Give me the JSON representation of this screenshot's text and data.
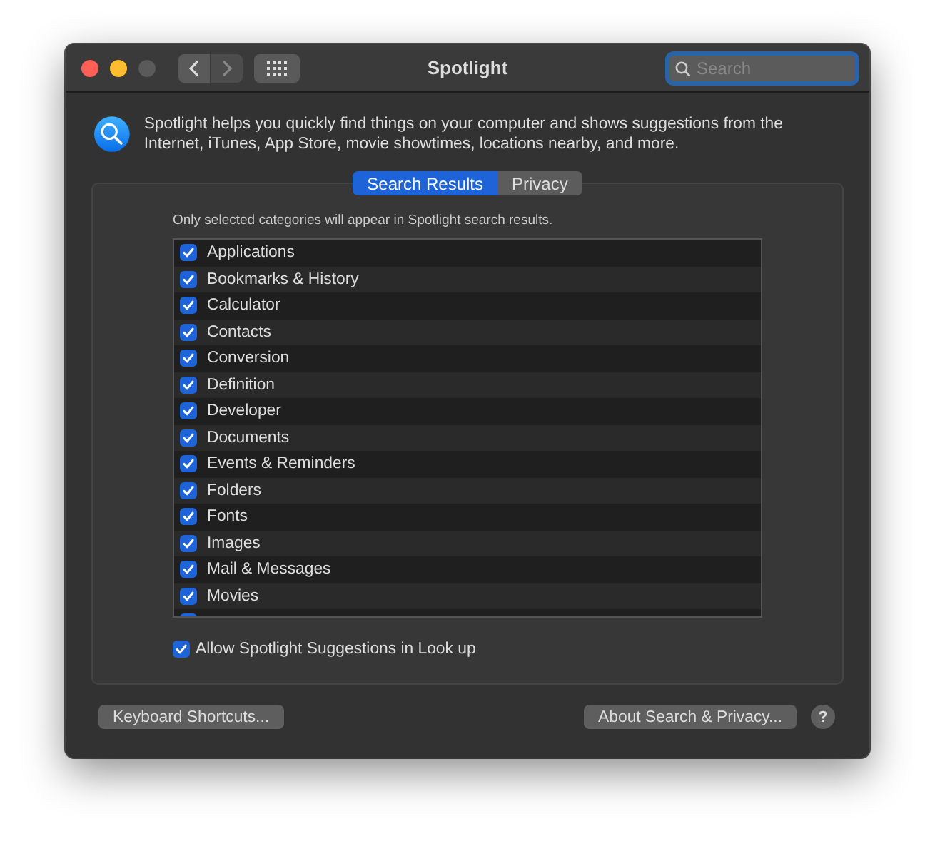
{
  "window": {
    "title": "Spotlight"
  },
  "search": {
    "placeholder": "Search"
  },
  "intro": "Spotlight helps you quickly find things on your computer and shows suggestions from the Internet, iTunes, App Store, movie showtimes, locations nearby, and more.",
  "tabs": [
    {
      "label": "Search Results",
      "selected": true
    },
    {
      "label": "Privacy",
      "selected": false
    }
  ],
  "hint": "Only selected categories will appear in Spotlight search results.",
  "categories": [
    {
      "label": "Applications",
      "checked": true
    },
    {
      "label": "Bookmarks & History",
      "checked": true
    },
    {
      "label": "Calculator",
      "checked": true
    },
    {
      "label": "Contacts",
      "checked": true
    },
    {
      "label": "Conversion",
      "checked": true
    },
    {
      "label": "Definition",
      "checked": true
    },
    {
      "label": "Developer",
      "checked": true
    },
    {
      "label": "Documents",
      "checked": true
    },
    {
      "label": "Events & Reminders",
      "checked": true
    },
    {
      "label": "Folders",
      "checked": true
    },
    {
      "label": "Fonts",
      "checked": true
    },
    {
      "label": "Images",
      "checked": true
    },
    {
      "label": "Mail & Messages",
      "checked": true
    },
    {
      "label": "Movies",
      "checked": true
    },
    {
      "checked": true
    }
  ],
  "lookup": {
    "label": "Allow Spotlight Suggestions in Look up",
    "checked": true
  },
  "buttons": {
    "left": "Keyboard Shortcuts...",
    "right": "About Search & Privacy...",
    "help": "?"
  }
}
